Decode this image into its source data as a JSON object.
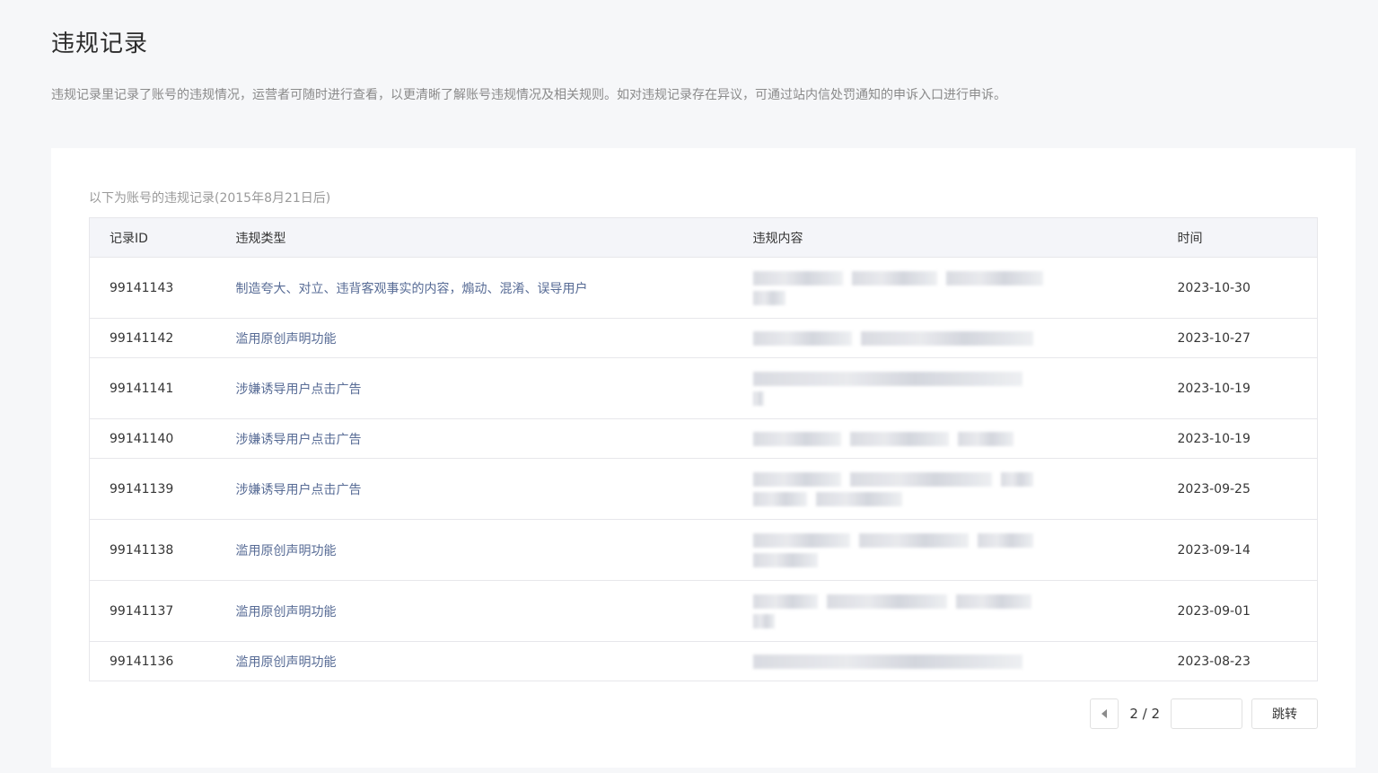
{
  "page": {
    "title": "违规记录",
    "description": "违规记录里记录了账号的违规情况，运营者可随时进行查看，以更清晰了解账号违规情况及相关规则。如对违规记录存在异议，可通过站内信处罚通知的申诉入口进行申诉。"
  },
  "card": {
    "hint": "以下为账号的违规记录(2015年8月21日后)"
  },
  "table": {
    "headers": {
      "id": "记录ID",
      "type": "违规类型",
      "content": "违规内容",
      "time": "时间"
    },
    "rows": [
      {
        "id": "99141143",
        "type": "制造夸大、对立、违背客观事实的内容，煽动、混淆、误导用户",
        "time": "2023-10-30"
      },
      {
        "id": "99141142",
        "type": "滥用原创声明功能",
        "time": "2023-10-27"
      },
      {
        "id": "99141141",
        "type": "涉嫌诱导用户点击广告",
        "time": "2023-10-19"
      },
      {
        "id": "99141140",
        "type": "涉嫌诱导用户点击广告",
        "time": "2023-10-19"
      },
      {
        "id": "99141139",
        "type": "涉嫌诱导用户点击广告",
        "time": "2023-09-25"
      },
      {
        "id": "99141138",
        "type": "滥用原创声明功能",
        "time": "2023-09-14"
      },
      {
        "id": "99141137",
        "type": "滥用原创声明功能",
        "time": "2023-09-01"
      },
      {
        "id": "99141136",
        "type": "滥用原创声明功能",
        "time": "2023-08-23"
      }
    ]
  },
  "pager": {
    "page_label": "2 / 2",
    "input_value": "",
    "go_label": "跳转"
  }
}
